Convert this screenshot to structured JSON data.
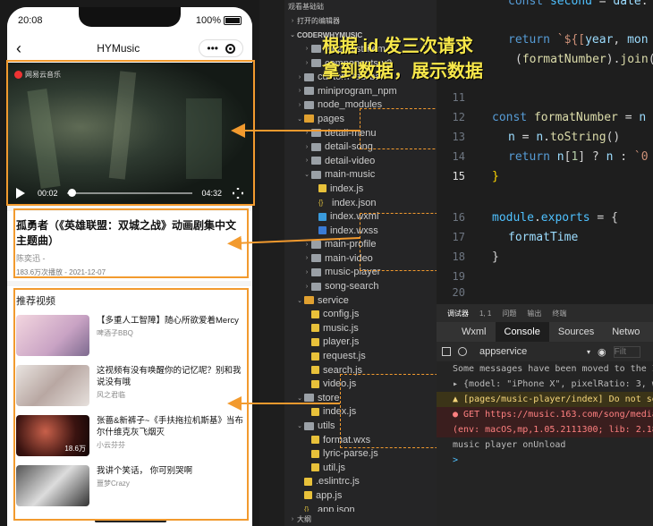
{
  "phone": {
    "time": "20:08",
    "battery": "100%",
    "nav_title": "HYMusic",
    "capsule_dots": "•••",
    "video": {
      "logo_text": "网易云音乐",
      "current_time": "00:02",
      "duration": "04:32",
      "progress_fraction": 0.01
    },
    "song": {
      "title": "孤勇者（《英雄联盟：双城之战》动画剧集中文主题曲）",
      "artist": "陈奕迅 -",
      "meta": "183.6万次播放 - 2021-12-07"
    },
    "recommend": {
      "title": "推荐视频",
      "items": [
        {
          "name": "【多重人工智障】随心所欲爱着Mercy",
          "author": "啤酒子BBQ",
          "count": ""
        },
        {
          "name": "这视频有没有唤醒你的记忆呢？别和我说没有哦",
          "author": "风之君临",
          "count": ""
        },
        {
          "name": "张蔷&新裤子~《手扶拖拉机斯基》当布尔什维克灰飞烟灭",
          "author": "小云芬芬",
          "count": "18.6万"
        },
        {
          "name": "我讲个笑话， 你可别哭啊",
          "author": "噩梦Crazy",
          "count": ""
        }
      ]
    }
  },
  "annotation": {
    "line1": "根据 id 发三次请求",
    "line2": "拿到数据，展示数据"
  },
  "explorer": {
    "header": "观看基础础",
    "open_editors": "打开的编辑器",
    "project": "CODERWHYMUSIC",
    "tree": [
      {
        "label": "video-list-item",
        "indent": 2,
        "type": "folder",
        "open": false
      },
      {
        "label": "components-v2",
        "indent": 2,
        "type": "folder",
        "open": false
      },
      {
        "label": "custom-tab-bar",
        "indent": 1,
        "type": "folder",
        "open": false
      },
      {
        "label": "miniprogram_npm",
        "indent": 1,
        "type": "folder",
        "open": false
      },
      {
        "label": "node_modules",
        "indent": 1,
        "type": "folder",
        "open": false
      },
      {
        "label": "pages",
        "indent": 1,
        "type": "folder-orange",
        "open": true
      },
      {
        "label": "detail-menu",
        "indent": 2,
        "type": "folder",
        "open": false
      },
      {
        "label": "detail-song",
        "indent": 2,
        "type": "folder",
        "open": false
      },
      {
        "label": "detail-video",
        "indent": 2,
        "type": "folder",
        "open": false
      },
      {
        "label": "main-music",
        "indent": 2,
        "type": "folder",
        "open": true
      },
      {
        "label": "index.js",
        "indent": 3,
        "type": "js"
      },
      {
        "label": "index.json",
        "indent": 3,
        "type": "json"
      },
      {
        "label": "index.wxml",
        "indent": 3,
        "type": "wxml"
      },
      {
        "label": "index.wxss",
        "indent": 3,
        "type": "wxss"
      },
      {
        "label": "main-profile",
        "indent": 2,
        "type": "folder",
        "open": false
      },
      {
        "label": "main-video",
        "indent": 2,
        "type": "folder",
        "open": false
      },
      {
        "label": "music-player",
        "indent": 2,
        "type": "folder",
        "open": false
      },
      {
        "label": "song-search",
        "indent": 2,
        "type": "folder",
        "open": false
      },
      {
        "label": "service",
        "indent": 1,
        "type": "folder-orange",
        "open": true
      },
      {
        "label": "config.js",
        "indent": 2,
        "type": "js"
      },
      {
        "label": "music.js",
        "indent": 2,
        "type": "js"
      },
      {
        "label": "player.js",
        "indent": 2,
        "type": "js"
      },
      {
        "label": "request.js",
        "indent": 2,
        "type": "js"
      },
      {
        "label": "search.js",
        "indent": 2,
        "type": "js"
      },
      {
        "label": "video.js",
        "indent": 2,
        "type": "js"
      },
      {
        "label": "store",
        "indent": 1,
        "type": "folder",
        "open": true
      },
      {
        "label": "index.js",
        "indent": 2,
        "type": "js"
      },
      {
        "label": "utils",
        "indent": 1,
        "type": "folder",
        "open": true
      },
      {
        "label": "format.wxs",
        "indent": 2,
        "type": "js"
      },
      {
        "label": "lyric-parse.js",
        "indent": 2,
        "type": "js"
      },
      {
        "label": "util.js",
        "indent": 2,
        "type": "js"
      },
      {
        "label": ".eslintrc.js",
        "indent": 1,
        "type": "js"
      },
      {
        "label": "app.js",
        "indent": 1,
        "type": "js"
      },
      {
        "label": "app.json",
        "indent": 1,
        "type": "json"
      }
    ],
    "outline": "大纲"
  },
  "editor": {
    "lines": [
      {
        "num": "",
        "active": false
      },
      {
        "num": "",
        "active": false
      },
      {
        "num": "",
        "active": false
      },
      {
        "num": "11",
        "active": false
      },
      {
        "num": "12",
        "active": false
      },
      {
        "num": "13",
        "active": false
      },
      {
        "num": "14",
        "active": false
      },
      {
        "num": "15",
        "active": true
      },
      {
        "num": "16",
        "active": false
      },
      {
        "num": "17",
        "active": false
      },
      {
        "num": "18",
        "active": false
      },
      {
        "num": "19",
        "active": false
      },
      {
        "num": "20",
        "active": false
      }
    ]
  },
  "debug": {
    "tabs": [
      "调试器",
      "1, 1",
      "问题",
      "输出",
      "终端"
    ],
    "dev_tabs": [
      "Wxml",
      "Console",
      "Sources",
      "Netwo"
    ],
    "active_dev_tab": "Console",
    "context": "appservice",
    "filter_placeholder": "Filt",
    "messages": [
      {
        "type": "info",
        "text": "Some messages have been moved to the I"
      },
      {
        "type": "info",
        "text": "▸ {model: \"iPhone X\", pixelRatio: 3, w"
      },
      {
        "type": "warn",
        "text": "▲ [pages/music-player/index] Do not set"
      },
      {
        "type": "err",
        "text": "● GET https://music.163.com/song/media/o"
      },
      {
        "type": "err",
        "text": "  (env: macOS,mp,1.05.2111300; lib: 2.18"
      },
      {
        "type": "info",
        "text": "music player onUnload"
      },
      {
        "type": "info",
        "text": ">"
      }
    ]
  },
  "colors": {
    "highlight": "#f29a2e",
    "annotation": "#f8e84a"
  }
}
